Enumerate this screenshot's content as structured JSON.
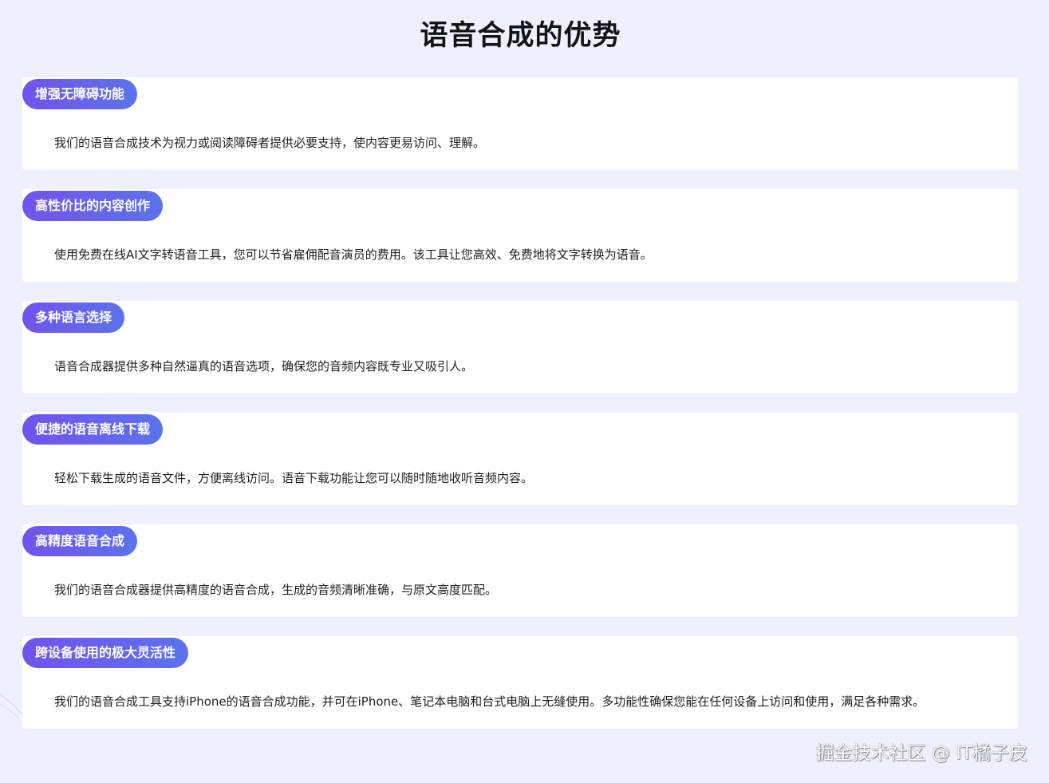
{
  "page": {
    "title": "语音合成的优势"
  },
  "features": [
    {
      "tag": "增强无障碍功能",
      "description": "我们的语音合成技术为视力或阅读障碍者提供必要支持，使内容更易访问、理解。"
    },
    {
      "tag": "高性价比的内容创作",
      "description": "使用免费在线AI文字转语音工具，您可以节省雇佣配音演员的费用。该工具让您高效、免费地将文字转换为语音。"
    },
    {
      "tag": "多种语言选择",
      "description": "语音合成器提供多种自然逼真的语音选项，确保您的音频内容既专业又吸引人。"
    },
    {
      "tag": "便捷的语音离线下载",
      "description": "轻松下载生成的语音文件，方便离线访问。语音下载功能让您可以随时随地收听音频内容。"
    },
    {
      "tag": "高精度语音合成",
      "description": "我们的语音合成器提供高精度的语音合成，生成的音频清晰准确，与原文高度匹配。"
    },
    {
      "tag": "跨设备使用的极大灵活性",
      "description": "我们的语音合成工具支持iPhone的语音合成功能，并可在iPhone、笔记本电脑和台式电脑上无缝使用。多功能性确保您能在任何设备上访问和使用，满足各种需求。"
    }
  ],
  "watermark": "掘金技术社区 @ IT橘子皮",
  "colors": {
    "background": "#eef1fd",
    "card": "#ffffff",
    "tag_gradient_start": "#7253ec",
    "tag_gradient_end": "#5b73ec",
    "title_text": "#141414",
    "body_text": "#1f1f1f"
  }
}
